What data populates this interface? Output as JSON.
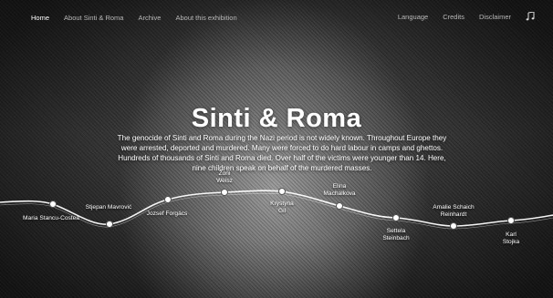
{
  "nav": {
    "left": [
      "Home",
      "About Sinti & Roma",
      "Archive",
      "About this exhibition"
    ],
    "right": [
      "Language",
      "Credits",
      "Disclaimer"
    ],
    "music_icon": "music-note-icon"
  },
  "hero": {
    "title": "Sinti & Roma",
    "intro": "The genocide of Sinti and Roma during the Nazi period is not widely known. Throughout Europe they were arrested, deported and murdered. Many were forced to do hard labour in camps and ghettos. Hundreds of thousands of Sinti and Roma died. Over half of the victims were younger than 14. Here, nine children speak on behalf of the murdered masses."
  },
  "timeline": {
    "people": [
      {
        "name": "Maria Stancu-Costea"
      },
      {
        "name": "Stjepan Mavrović"
      },
      {
        "name": "Jozsef Forgács"
      },
      {
        "name": "Zoni Weisz"
      },
      {
        "name": "Krystyna Gil"
      },
      {
        "name": "Elina Machalkova"
      },
      {
        "name": "Settela Steinbach"
      },
      {
        "name": "Amalie Schaich Reinhardt"
      },
      {
        "name": "Karl Stojka"
      }
    ]
  }
}
